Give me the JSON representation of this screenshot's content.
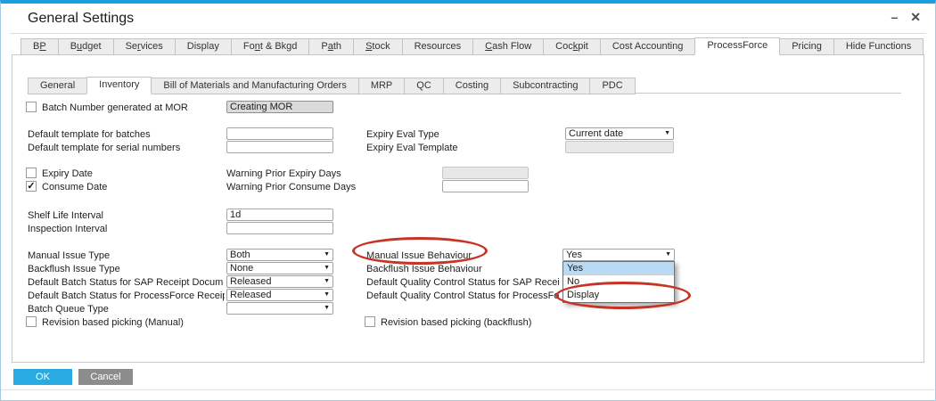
{
  "window": {
    "title": "General Settings",
    "controls": {
      "minimize": "–",
      "close": "✕"
    }
  },
  "primary_tabs": [
    {
      "label": "BP",
      "underline": 1
    },
    {
      "label": "Budget",
      "underline": 1
    },
    {
      "label": "Services",
      "underline": 2
    },
    {
      "label": "Display"
    },
    {
      "label": "Font & Bkgd",
      "underline": 2
    },
    {
      "label": "Path",
      "underline": 1
    },
    {
      "label": "Stock",
      "underline": 0
    },
    {
      "label": "Resources"
    },
    {
      "label": "Cash Flow",
      "underline": 0
    },
    {
      "label": "Cockpit",
      "underline": 3
    },
    {
      "label": "Cost Accounting"
    },
    {
      "label": "ProcessForce",
      "active": true
    },
    {
      "label": "Pricing"
    },
    {
      "label": "Hide Functions"
    }
  ],
  "secondary_tabs": [
    {
      "label": "General"
    },
    {
      "label": "Inventory",
      "active": true
    },
    {
      "label": "Bill of Materials and Manufacturing Orders"
    },
    {
      "label": "MRP"
    },
    {
      "label": "QC"
    },
    {
      "label": "Costing"
    },
    {
      "label": "Subcontracting"
    },
    {
      "label": "PDC"
    }
  ],
  "form": {
    "batch_number_mor": {
      "label": "Batch Number generated at MOR",
      "checked": false,
      "value": "Creating MOR"
    },
    "default_template_batches": {
      "label": "Default template for batches",
      "value": ""
    },
    "default_template_serial": {
      "label": "Default template for serial numbers",
      "value": ""
    },
    "expiry_eval_type": {
      "label": "Expiry Eval Type",
      "value": "Current date"
    },
    "expiry_eval_template": {
      "label": "Expiry Eval Template",
      "value": ""
    },
    "expiry_date": {
      "label": "Expiry Date",
      "checked": false
    },
    "warning_prior_expiry_days": {
      "label": "Warning Prior Expiry Days",
      "value": ""
    },
    "consume_date": {
      "label": "Consume Date",
      "checked": true
    },
    "warning_prior_consume_days": {
      "label": "Warning Prior Consume Days",
      "value": ""
    },
    "shelf_life_interval": {
      "label": "Shelf Life Interval",
      "value": "1d"
    },
    "inspection_interval": {
      "label": "Inspection Interval",
      "value": ""
    },
    "manual_issue_type": {
      "label": "Manual Issue Type",
      "value": "Both"
    },
    "backflush_issue_type": {
      "label": "Backflush Issue Type",
      "value": "None"
    },
    "default_batch_status_sap": {
      "label": "Default Batch Status for SAP Receipt Docum",
      "value": "Released"
    },
    "default_batch_status_pf": {
      "label": "Default Batch Status for ProcessForce Receip",
      "value": "Released"
    },
    "batch_queue_type": {
      "label": "Batch Queue Type",
      "value": ""
    },
    "revision_picking_manual": {
      "label": "Revision based picking (Manual)",
      "checked": false
    },
    "manual_issue_behaviour": {
      "label": "Manual Issue Behaviour",
      "value": "Yes",
      "options": [
        "Yes",
        "No",
        "Display"
      ],
      "highlighted_option": "Yes",
      "circled_option": "Display"
    },
    "backflush_issue_behaviour": {
      "label": "Backflush Issue Behaviour"
    },
    "default_qc_status_sap": {
      "label": "Default Quality Control Status for SAP Recei"
    },
    "default_qc_status_pf": {
      "label": "Default Quality Control Status for ProcessFo"
    },
    "revision_picking_backflush": {
      "label": "Revision based picking (backflush)",
      "checked": false
    }
  },
  "buttons": {
    "ok": "OK",
    "cancel": "Cancel"
  },
  "colors": {
    "accent_blue": "#29abe2",
    "window_border_blue": "#1b9fe0",
    "annotation_red": "#c53425",
    "dropdown_highlight": "#badaf3",
    "cancel_gray": "#8c8c8c"
  }
}
